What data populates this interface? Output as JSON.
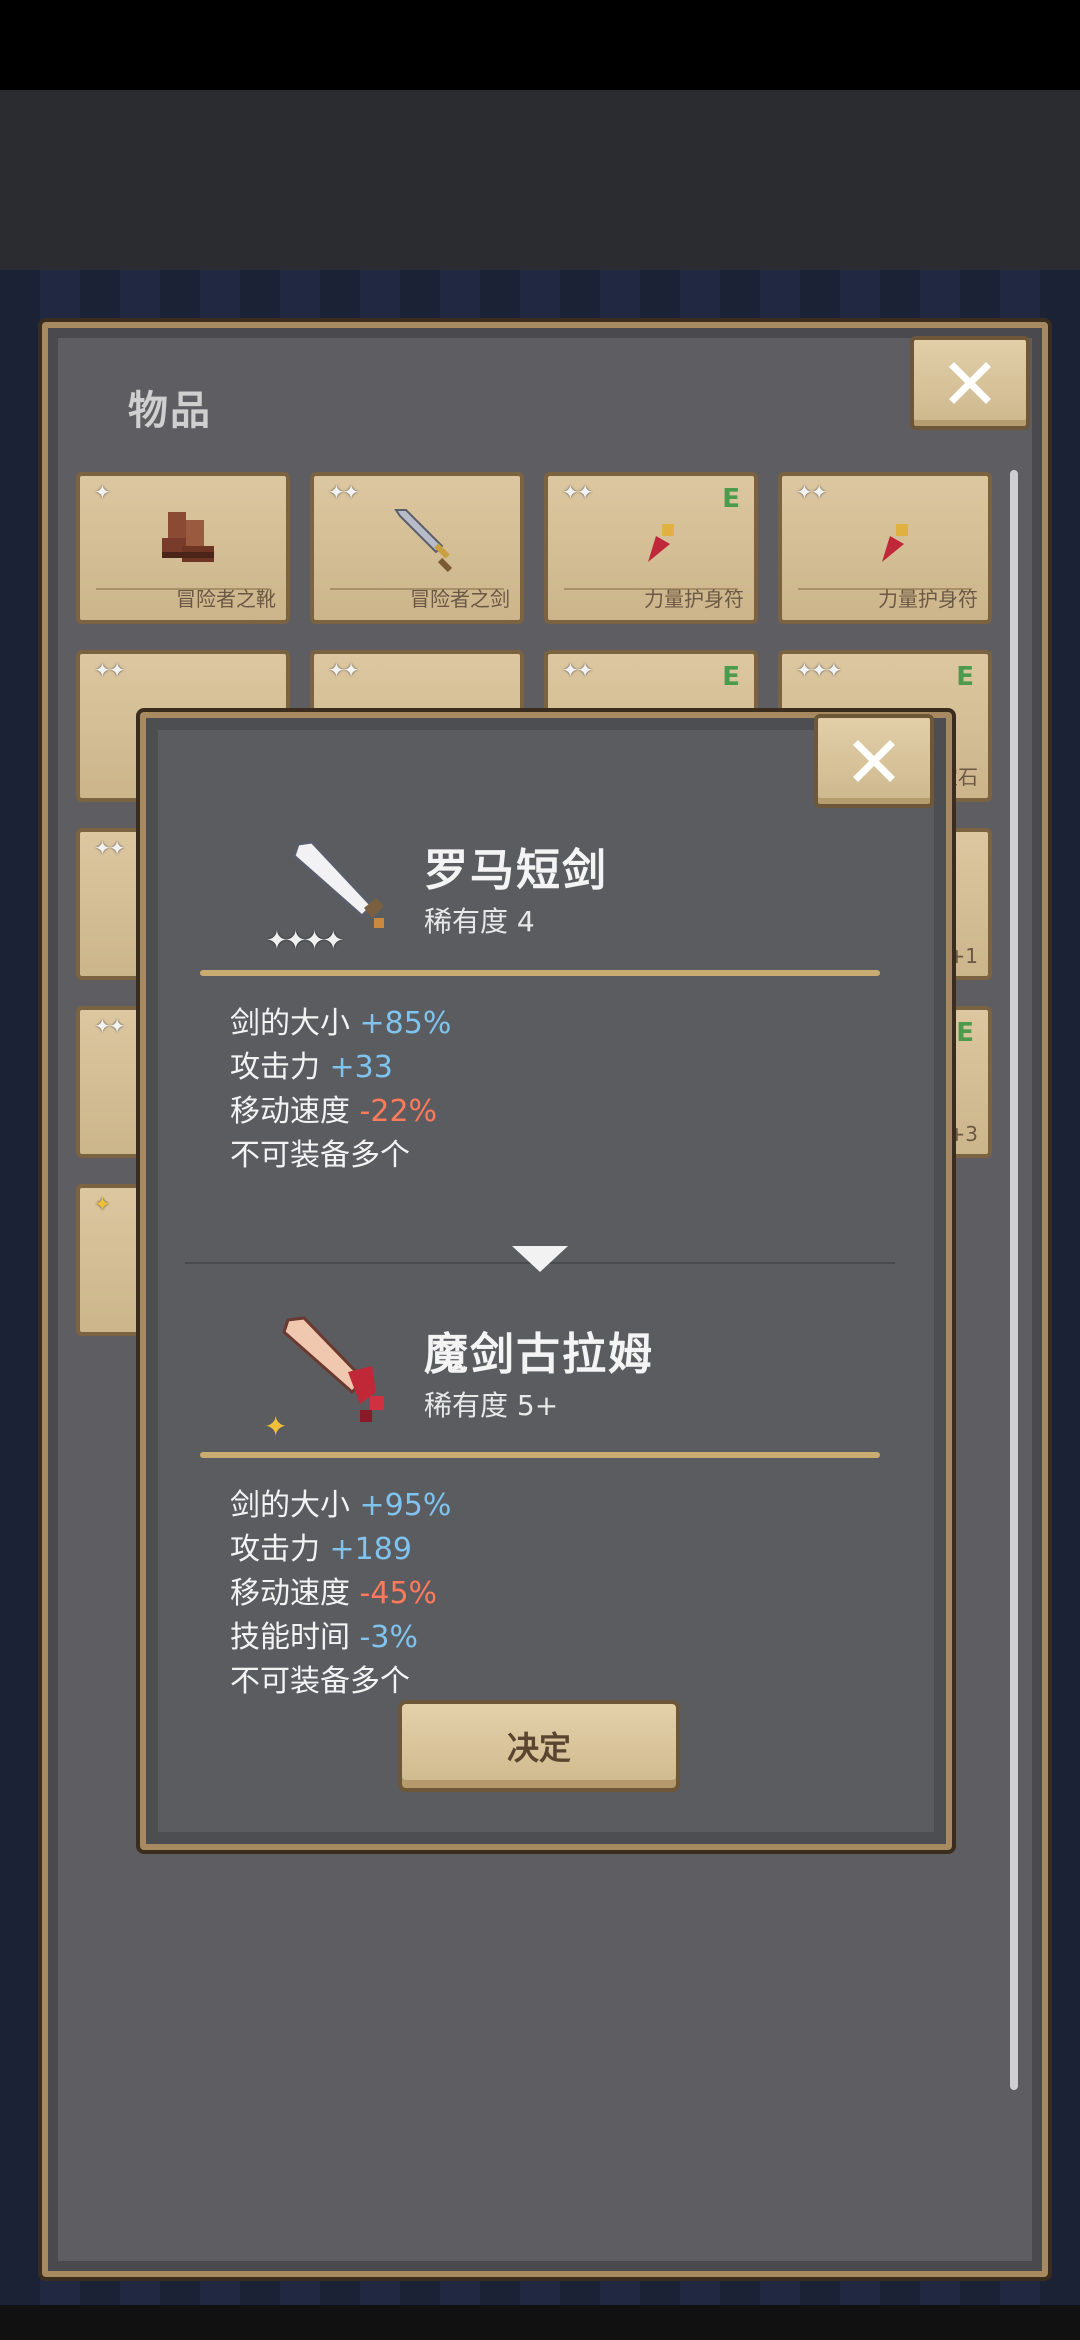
{
  "inventory": {
    "title": "物品",
    "slots": [
      {
        "stars": "✦",
        "name": "冒险者之靴",
        "equipped": ""
      },
      {
        "stars": "✦✦",
        "name": "冒险者之剑",
        "equipped": ""
      },
      {
        "stars": "✦✦",
        "name": "力量护身符",
        "equipped": "E"
      },
      {
        "stars": "✦✦",
        "name": "力量护身符",
        "equipped": ""
      },
      {
        "stars": "✦✦",
        "name": "",
        "equipped": ""
      },
      {
        "stars": "✦✦",
        "name": "",
        "equipped": ""
      },
      {
        "stars": "✦✦",
        "name": "",
        "equipped": "E"
      },
      {
        "stars": "✦✦✦",
        "name": "宝石",
        "equipped": "E"
      },
      {
        "stars": "✦✦",
        "name": "",
        "equipped": ""
      },
      {
        "stars": "",
        "name": "+1",
        "equipped": ""
      },
      {
        "stars": "✦✦",
        "name": "",
        "equipped": ""
      },
      {
        "stars": "",
        "name": "+3",
        "equipped": "E"
      },
      {
        "stars": "✦",
        "name": "",
        "equipped": ""
      }
    ]
  },
  "popup": {
    "current": {
      "name": "罗马短剑",
      "rarity": "稀有度 4",
      "stars": "✦✦✦✦",
      "stats": [
        {
          "label": "剑的大小",
          "value": "+85%"
        },
        {
          "label": "攻击力",
          "value": "+33"
        },
        {
          "label": "移动速度",
          "value": "-22%"
        },
        {
          "label": "不可装备多个",
          "value": ""
        }
      ]
    },
    "new": {
      "name": "魔剑古拉姆",
      "rarity": "稀有度 5+",
      "sparkle": "✦",
      "stats": [
        {
          "label": "剑的大小",
          "value": "+95%"
        },
        {
          "label": "攻击力",
          "value": "+189"
        },
        {
          "label": "移动速度",
          "value": "-45%"
        },
        {
          "label": "技能时间",
          "value": "-3%"
        },
        {
          "label": "不可装备多个",
          "value": ""
        }
      ]
    },
    "confirm_label": "决定"
  },
  "colors": {
    "positive": "#7fc3ee",
    "negative": "#ff7a5a",
    "panel_border": "#a88a60",
    "slot_bg": "#dcc7a0"
  },
  "icons": [
    "close-icon",
    "boots-icon",
    "sword-icon",
    "amulet-icon",
    "arrow-down-icon"
  ]
}
